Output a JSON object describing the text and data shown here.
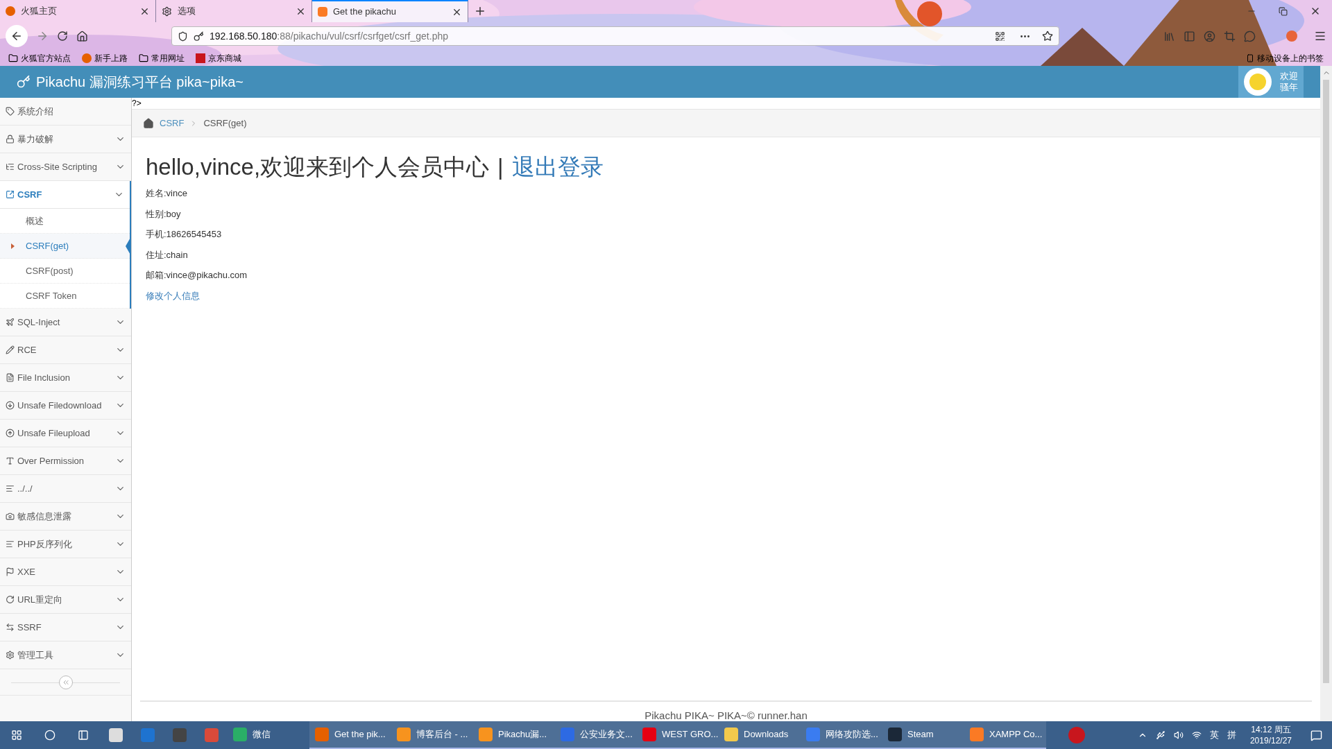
{
  "browser": {
    "tabs": [
      {
        "title": "火狐主页",
        "selected": false
      },
      {
        "title": "选项",
        "selected": false
      },
      {
        "title": "Get the pikachu",
        "selected": true
      }
    ],
    "address": {
      "host": "192.168.50.180",
      "rest": ":88/pikachu/vul/csrf/csrfget/csrf_get.php"
    },
    "bookmarks": [
      "火狐官方站点",
      "新手上路",
      "常用网址",
      "京东商城"
    ],
    "mobile_bookmarks": "移动设备上的书签"
  },
  "header": {
    "title": "Pikachu 漏洞练习平台 pika~pika~",
    "greeting": [
      "欢迎",
      "骚年"
    ]
  },
  "sidebar": {
    "items": [
      {
        "label": "系统介绍",
        "kind": "link",
        "expanded": false
      },
      {
        "label": "暴力破解",
        "kind": "menu",
        "expanded": false
      },
      {
        "label": "Cross-Site Scripting",
        "kind": "menu",
        "expanded": false
      },
      {
        "label": "CSRF",
        "kind": "menu",
        "expanded": true,
        "children": [
          {
            "label": "概述",
            "selected": false
          },
          {
            "label": "CSRF(get)",
            "selected": true
          },
          {
            "label": "CSRF(post)",
            "selected": false
          },
          {
            "label": "CSRF Token",
            "selected": false
          }
        ]
      },
      {
        "label": "SQL-Inject",
        "kind": "menu",
        "expanded": false
      },
      {
        "label": "RCE",
        "kind": "menu",
        "expanded": false
      },
      {
        "label": "File Inclusion",
        "kind": "menu",
        "expanded": false
      },
      {
        "label": "Unsafe Filedownload",
        "kind": "menu",
        "expanded": false
      },
      {
        "label": "Unsafe Fileupload",
        "kind": "menu",
        "expanded": false
      },
      {
        "label": "Over Permission",
        "kind": "menu",
        "expanded": false
      },
      {
        "label": "../../",
        "kind": "menu",
        "expanded": false
      },
      {
        "label": "敏感信息泄露",
        "kind": "menu",
        "expanded": false
      },
      {
        "label": "PHP反序列化",
        "kind": "menu",
        "expanded": false
      },
      {
        "label": "XXE",
        "kind": "menu",
        "expanded": false
      },
      {
        "label": "URL重定向",
        "kind": "menu",
        "expanded": false
      },
      {
        "label": "SSRF",
        "kind": "menu",
        "expanded": false
      },
      {
        "label": "管理工具",
        "kind": "menu",
        "expanded": false
      }
    ]
  },
  "content": {
    "stray_text": "?>",
    "breadcrumb": [
      "CSRF",
      "CSRF(get)"
    ],
    "heading": "hello,vince,欢迎来到个人会员中心",
    "separator": "|",
    "logout_link": "退出登录",
    "fields": [
      "姓名:vince",
      "性别:boy",
      "手机:18626545453",
      "住址:chain",
      "邮箱:vince@pikachu.com"
    ],
    "edit_link": "修改个人信息",
    "footer": "Pikachu PIKA~ PIKA~© runner.han"
  },
  "taskbar": {
    "apps": [
      {
        "label": "微信",
        "active": false
      },
      {
        "label": "Get the pik...",
        "active": true
      },
      {
        "label": "博客后台 - ...",
        "active": true
      },
      {
        "label": "Pikachu漏...",
        "active": true
      },
      {
        "label": "公安业务文...",
        "active": true
      },
      {
        "label": "WEST GRO...",
        "active": true
      },
      {
        "label": "Downloads",
        "active": true
      },
      {
        "label": "网络攻防选...",
        "active": true
      },
      {
        "label": "Steam",
        "active": true
      },
      {
        "label": "XAMPP Co...",
        "active": true
      }
    ],
    "ime": [
      "英",
      "拼"
    ],
    "time": "14:12 周五",
    "date": "2019/12/27"
  }
}
